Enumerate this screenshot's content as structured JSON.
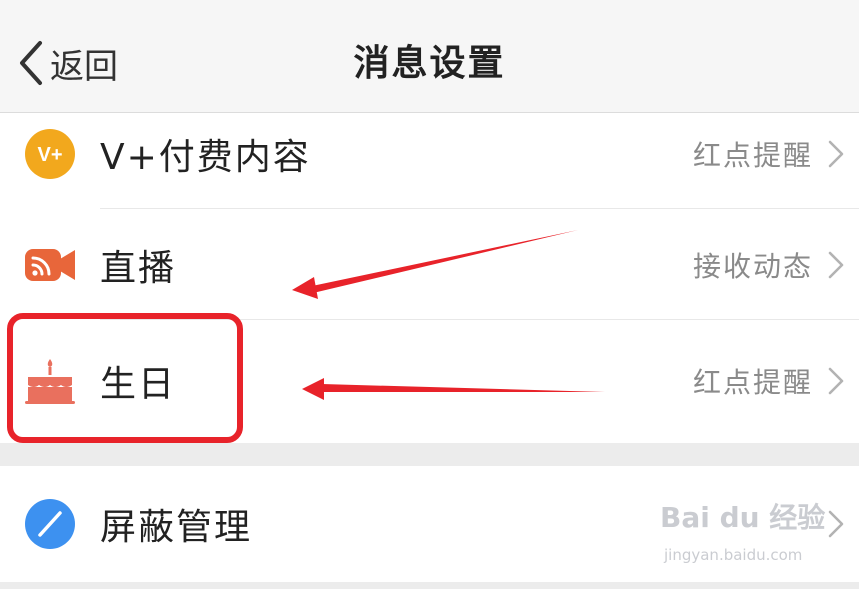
{
  "nav": {
    "back_label": "返回",
    "title": "消息设置"
  },
  "rows": [
    {
      "id": "vplus",
      "label": "V+付费内容",
      "value": "红点提醒",
      "icon": "vplus-icon"
    },
    {
      "id": "live",
      "label": "直播",
      "value": "接收动态",
      "icon": "live-camera-icon"
    },
    {
      "id": "birthday",
      "label": "生日",
      "value": "红点提醒",
      "icon": "birthday-cake-icon"
    },
    {
      "id": "block",
      "label": "屏蔽管理",
      "value": "",
      "icon": "block-icon"
    }
  ],
  "vplus_badge": "V+",
  "watermark": {
    "logo": "Bai du 经验",
    "url": "jingyan.baidu.com"
  },
  "colors": {
    "vplus_icon": "#f2a81d",
    "live_icon": "#e8663a",
    "birthday_icon": "#e9705e",
    "block_icon": "#3d91f0",
    "highlight": "#e8232a",
    "arrow": "#e8232a"
  }
}
